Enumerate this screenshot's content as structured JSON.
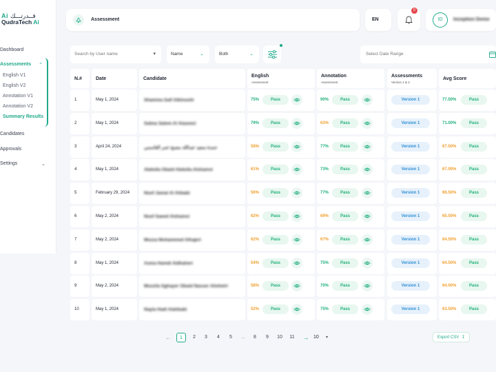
{
  "logo": {
    "ar_text": "قــدرتـــك",
    "ar_ai": "Ai",
    "en_text": "QudraTech",
    "en_ai": "Ai"
  },
  "sidebar": {
    "dashboard": "Dashboard",
    "assessments": "Assessments",
    "sub_items": [
      "English V1",
      "English V2",
      "Annotation V1",
      "Annotation V2",
      "Summary Results"
    ],
    "candidates": "Candidates",
    "approvals": "Approvals",
    "settings": "Settings"
  },
  "header": {
    "title": "Assessment",
    "lang": "EN",
    "notif_count": "0",
    "avatar_initials": "ID",
    "user_name": "Inception Demo"
  },
  "filters": {
    "search_placeholder": "Search by User name",
    "sort_by": "Name",
    "type": "Both",
    "date_placeholder": "Select Date Range"
  },
  "table": {
    "headers": {
      "num": "N.#",
      "date": "Date",
      "candidate": "Candidate",
      "english": "English",
      "english_sub": "Assessment",
      "annotation": "Annotation",
      "annotation_sub": "Assessment",
      "assessments": "Assessments",
      "assessments_sub": "Version 1 & 2",
      "avg": "Avg Score"
    },
    "rows": [
      {
        "n": "1",
        "date": "May 1, 2024",
        "candidate": "Shamma Saif Albinuohi",
        "eng": "75%",
        "eng_status": "Pass",
        "ann": "90%",
        "ann_status": "Pass",
        "version": "Version 1",
        "avg": "77.50%",
        "avg_status": "Pass"
      },
      {
        "n": "2",
        "date": "May 1, 2024",
        "candidate": "Salma Salem Al Alazeezi",
        "eng": "79%",
        "eng_status": "Pass",
        "ann": "63%",
        "ann_status": "Pass",
        "version": "Version 1",
        "avg": "71.00%",
        "avg_status": "Pass"
      },
      {
        "n": "3",
        "date": "April 24, 2024",
        "candidate": "حمدة سعيد عبدالله مصبح عمر القاسمي",
        "eng": "58%",
        "eng_status": "Pass",
        "ann": "77%",
        "ann_status": "Pass",
        "version": "Version 1",
        "avg": "67.50%",
        "avg_status": "Pass"
      },
      {
        "n": "4",
        "date": "May 1, 2024",
        "candidate": "Abdulla Obaid Abdulla Alshamsi",
        "eng": "61%",
        "eng_status": "Pass",
        "ann": "73%",
        "ann_status": "Pass",
        "version": "Version 1",
        "avg": "67.00%",
        "avg_status": "Pass"
      },
      {
        "n": "5",
        "date": "February 29, 2024",
        "candidate": "Noof Jamal Al Ahbabi",
        "eng": "56%",
        "eng_status": "Pass",
        "ann": "77%",
        "ann_status": "Pass",
        "version": "Version 1",
        "avg": "66.50%",
        "avg_status": "Pass"
      },
      {
        "n": "6",
        "date": "May 2, 2024",
        "candidate": "Noof Saeed Alshamsi",
        "eng": "62%",
        "eng_status": "Pass",
        "ann": "69%",
        "ann_status": "Pass",
        "version": "Version 1",
        "avg": "65.50%",
        "avg_status": "Pass"
      },
      {
        "n": "7",
        "date": "May 2, 2024",
        "candidate": "Mozza Mohammed Alhajeri",
        "eng": "62%",
        "eng_status": "Pass",
        "ann": "67%",
        "ann_status": "Pass",
        "version": "Version 1",
        "avg": "64.50%",
        "avg_status": "Pass"
      },
      {
        "n": "8",
        "date": "May 1, 2024",
        "candidate": "Asma Hamdi Aldhaheri",
        "eng": "54%",
        "eng_status": "Pass",
        "ann": "75%",
        "ann_status": "Pass",
        "version": "Version 1",
        "avg": "64.50%",
        "avg_status": "Pass"
      },
      {
        "n": "9",
        "date": "May 2, 2024",
        "candidate": "Mozzila Sghayer Obaid Nasser Almheiri",
        "eng": "58%",
        "eng_status": "Pass",
        "ann": "70%",
        "ann_status": "Pass",
        "version": "Version 1",
        "avg": "64.00%",
        "avg_status": "Pass"
      },
      {
        "n": "10",
        "date": "May 1, 2024",
        "candidate": "Nayla Hadi Alahbabi",
        "eng": "52%",
        "eng_status": "Pass",
        "ann": "75%",
        "ann_status": "Pass",
        "version": "Version 1",
        "avg": "63.50%",
        "avg_status": "Pass"
      }
    ]
  },
  "pagination": {
    "pages": [
      "1",
      "2",
      "3",
      "4",
      "5",
      "...",
      "8",
      "9",
      "10",
      "11"
    ],
    "per_page": "10",
    "export_label": "Export CSV"
  },
  "colors": {
    "accent": "#1fa98a",
    "pass_green": "#22b07d",
    "warn_orange": "#f0a030",
    "version_blue": "#2d8fd6"
  }
}
